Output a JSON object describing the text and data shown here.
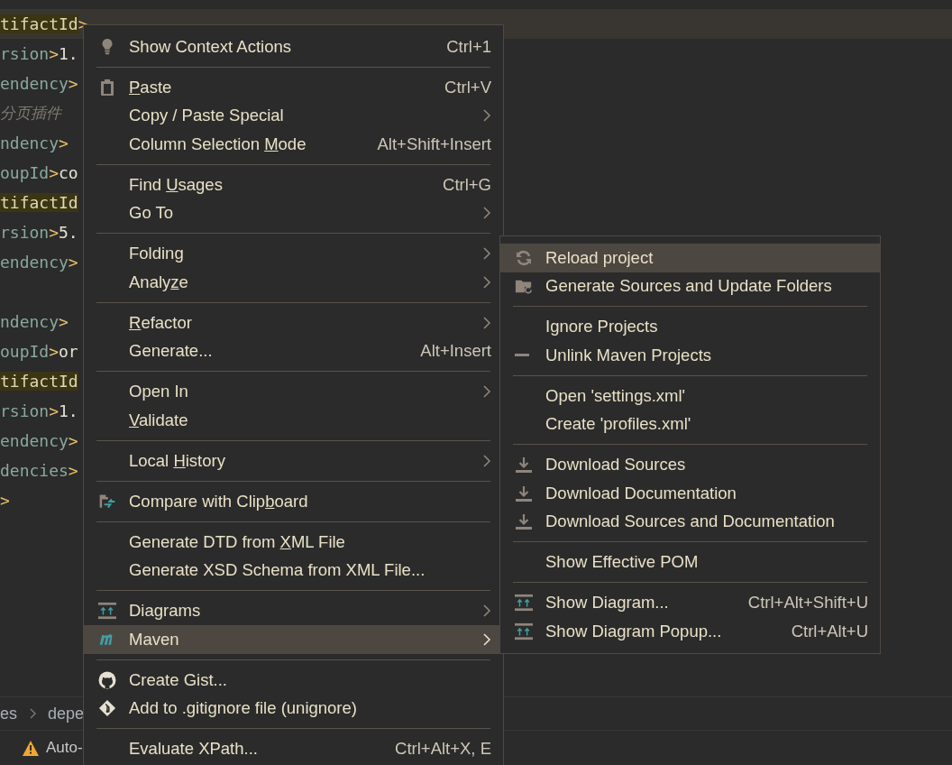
{
  "editor": {
    "lines": [
      {
        "current": true,
        "parts": [
          {
            "text": "tifactId",
            "kind": "tag",
            "highlight": true
          },
          {
            "text": ">",
            "kind": "bracket",
            "highlight": false
          }
        ]
      },
      {
        "current": false,
        "parts": [
          {
            "text": "rsion",
            "kind": "tag",
            "highlight": false
          },
          {
            "text": ">",
            "kind": "bracket",
            "highlight": false
          },
          {
            "text": "1.",
            "kind": "value",
            "highlight": false
          }
        ]
      },
      {
        "current": false,
        "parts": [
          {
            "text": "endency",
            "kind": "tag",
            "highlight": false
          },
          {
            "text": ">",
            "kind": "bracket",
            "highlight": false
          }
        ]
      },
      {
        "current": false,
        "parts": [
          {
            "text": "分页插件",
            "kind": "comment",
            "highlight": false
          }
        ]
      },
      {
        "current": false,
        "parts": [
          {
            "text": "ndency",
            "kind": "tag",
            "highlight": false
          },
          {
            "text": ">",
            "kind": "bracket",
            "highlight": false
          }
        ]
      },
      {
        "current": false,
        "parts": [
          {
            "text": "oupId",
            "kind": "tag",
            "highlight": false
          },
          {
            "text": ">",
            "kind": "bracket",
            "highlight": false
          },
          {
            "text": "co",
            "kind": "value",
            "highlight": false
          }
        ]
      },
      {
        "current": false,
        "parts": [
          {
            "text": "tifactId",
            "kind": "tag",
            "highlight": true
          }
        ]
      },
      {
        "current": false,
        "parts": [
          {
            "text": "rsion",
            "kind": "tag",
            "highlight": false
          },
          {
            "text": ">",
            "kind": "bracket",
            "highlight": false
          },
          {
            "text": "5.",
            "kind": "value",
            "highlight": false
          }
        ]
      },
      {
        "current": false,
        "parts": [
          {
            "text": "endency",
            "kind": "tag",
            "highlight": false
          },
          {
            "text": ">",
            "kind": "bracket",
            "highlight": false
          }
        ]
      },
      {
        "current": false
      },
      {
        "current": false,
        "parts": [
          {
            "text": "ndency",
            "kind": "tag",
            "highlight": false
          },
          {
            "text": ">",
            "kind": "bracket",
            "highlight": false
          }
        ]
      },
      {
        "current": false,
        "parts": [
          {
            "text": "oupId",
            "kind": "tag",
            "highlight": false
          },
          {
            "text": ">",
            "kind": "bracket",
            "highlight": false
          },
          {
            "text": "or",
            "kind": "value",
            "highlight": false
          }
        ]
      },
      {
        "current": false,
        "parts": [
          {
            "text": "tifactId",
            "kind": "tag",
            "highlight": true
          }
        ]
      },
      {
        "current": false,
        "parts": [
          {
            "text": "rsion",
            "kind": "tag",
            "highlight": false
          },
          {
            "text": ">",
            "kind": "bracket",
            "highlight": false
          },
          {
            "text": "1.",
            "kind": "value",
            "highlight": false
          }
        ]
      },
      {
        "current": false,
        "parts": [
          {
            "text": "endency",
            "kind": "tag",
            "highlight": false
          },
          {
            "text": ">",
            "kind": "bracket",
            "highlight": false
          }
        ]
      },
      {
        "current": false,
        "parts": [
          {
            "text": "dencies",
            "kind": "tag",
            "highlight": false
          },
          {
            "text": ">",
            "kind": "bracket",
            "highlight": false
          }
        ]
      },
      {
        "current": false,
        "parts": [
          {
            "text": ">",
            "kind": "bracket",
            "highlight": false
          }
        ]
      }
    ]
  },
  "breadcrumbs": [
    "es",
    "depe"
  ],
  "status_bar": {
    "warning": "Auto-"
  },
  "context_menu": [
    {
      "kind": "item",
      "label": "Show Context Actions",
      "shortcut": "Ctrl+1",
      "submenu": false,
      "selected": false
    },
    {
      "kind": "separator"
    },
    {
      "kind": "item",
      "label": "Paste",
      "shortcut": "Ctrl+V",
      "submenu": false,
      "selected": false
    },
    {
      "kind": "item",
      "label": "Copy / Paste Special",
      "submenu": true,
      "selected": false
    },
    {
      "kind": "item",
      "label": "Column Selection Mode",
      "shortcut": "Alt+Shift+Insert",
      "submenu": false,
      "selected": false
    },
    {
      "kind": "separator"
    },
    {
      "kind": "item",
      "label": "Find Usages",
      "shortcut": "Ctrl+G",
      "submenu": false,
      "selected": false
    },
    {
      "kind": "item",
      "label": "Go To",
      "submenu": true,
      "selected": false
    },
    {
      "kind": "separator"
    },
    {
      "kind": "item",
      "label": "Folding",
      "submenu": true,
      "selected": false
    },
    {
      "kind": "item",
      "label": "Analyze",
      "submenu": true,
      "selected": false
    },
    {
      "kind": "separator"
    },
    {
      "kind": "item",
      "label": "Refactor",
      "submenu": true,
      "selected": false
    },
    {
      "kind": "item",
      "label": "Generate...",
      "shortcut": "Alt+Insert",
      "submenu": false,
      "selected": false
    },
    {
      "kind": "separator"
    },
    {
      "kind": "item",
      "label": "Open In",
      "submenu": true,
      "selected": false
    },
    {
      "kind": "item",
      "label": "Validate",
      "submenu": false,
      "selected": false
    },
    {
      "kind": "separator"
    },
    {
      "kind": "item",
      "label": "Local History",
      "submenu": true,
      "selected": false
    },
    {
      "kind": "separator"
    },
    {
      "kind": "item",
      "label": "Compare with Clipboard",
      "submenu": false,
      "selected": false
    },
    {
      "kind": "separator"
    },
    {
      "kind": "item",
      "label": "Generate DTD from XML File",
      "submenu": false,
      "selected": false
    },
    {
      "kind": "item",
      "label": "Generate XSD Schema from XML File...",
      "submenu": false,
      "selected": false
    },
    {
      "kind": "separator"
    },
    {
      "kind": "item",
      "label": "Diagrams",
      "submenu": true,
      "selected": false
    },
    {
      "kind": "item",
      "label": "Maven",
      "submenu": true,
      "selected": true
    },
    {
      "kind": "separator"
    },
    {
      "kind": "item",
      "label": "Create Gist...",
      "submenu": false,
      "selected": false
    },
    {
      "kind": "item",
      "label": "Add to .gitignore file (unignore)",
      "submenu": false,
      "selected": false
    },
    {
      "kind": "separator"
    },
    {
      "kind": "item",
      "label": "Evaluate XPath...",
      "shortcut": "Ctrl+Alt+X, E",
      "submenu": false,
      "selected": false
    }
  ],
  "maven_submenu": [
    {
      "kind": "item",
      "label": "Reload project",
      "selected": true
    },
    {
      "kind": "item",
      "label": "Generate Sources and Update Folders",
      "selected": false
    },
    {
      "kind": "separator"
    },
    {
      "kind": "item",
      "label": "Ignore Projects",
      "selected": false
    },
    {
      "kind": "item",
      "label": "Unlink Maven Projects",
      "selected": false
    },
    {
      "kind": "separator"
    },
    {
      "kind": "item",
      "label": "Open 'settings.xml'",
      "selected": false
    },
    {
      "kind": "item",
      "label": "Create 'profiles.xml'",
      "selected": false
    },
    {
      "kind": "separator"
    },
    {
      "kind": "item",
      "label": "Download Sources",
      "selected": false
    },
    {
      "kind": "item",
      "label": "Download Documentation",
      "selected": false
    },
    {
      "kind": "item",
      "label": "Download Sources and Documentation",
      "selected": false
    },
    {
      "kind": "separator"
    },
    {
      "kind": "item",
      "label": "Show Effective POM",
      "selected": false
    },
    {
      "kind": "separator"
    },
    {
      "kind": "item",
      "label": "Show Diagram...",
      "shortcut": "Ctrl+Alt+Shift+U",
      "selected": false
    },
    {
      "kind": "item",
      "label": "Show Diagram Popup...",
      "shortcut": "Ctrl+Alt+U",
      "selected": false
    }
  ]
}
